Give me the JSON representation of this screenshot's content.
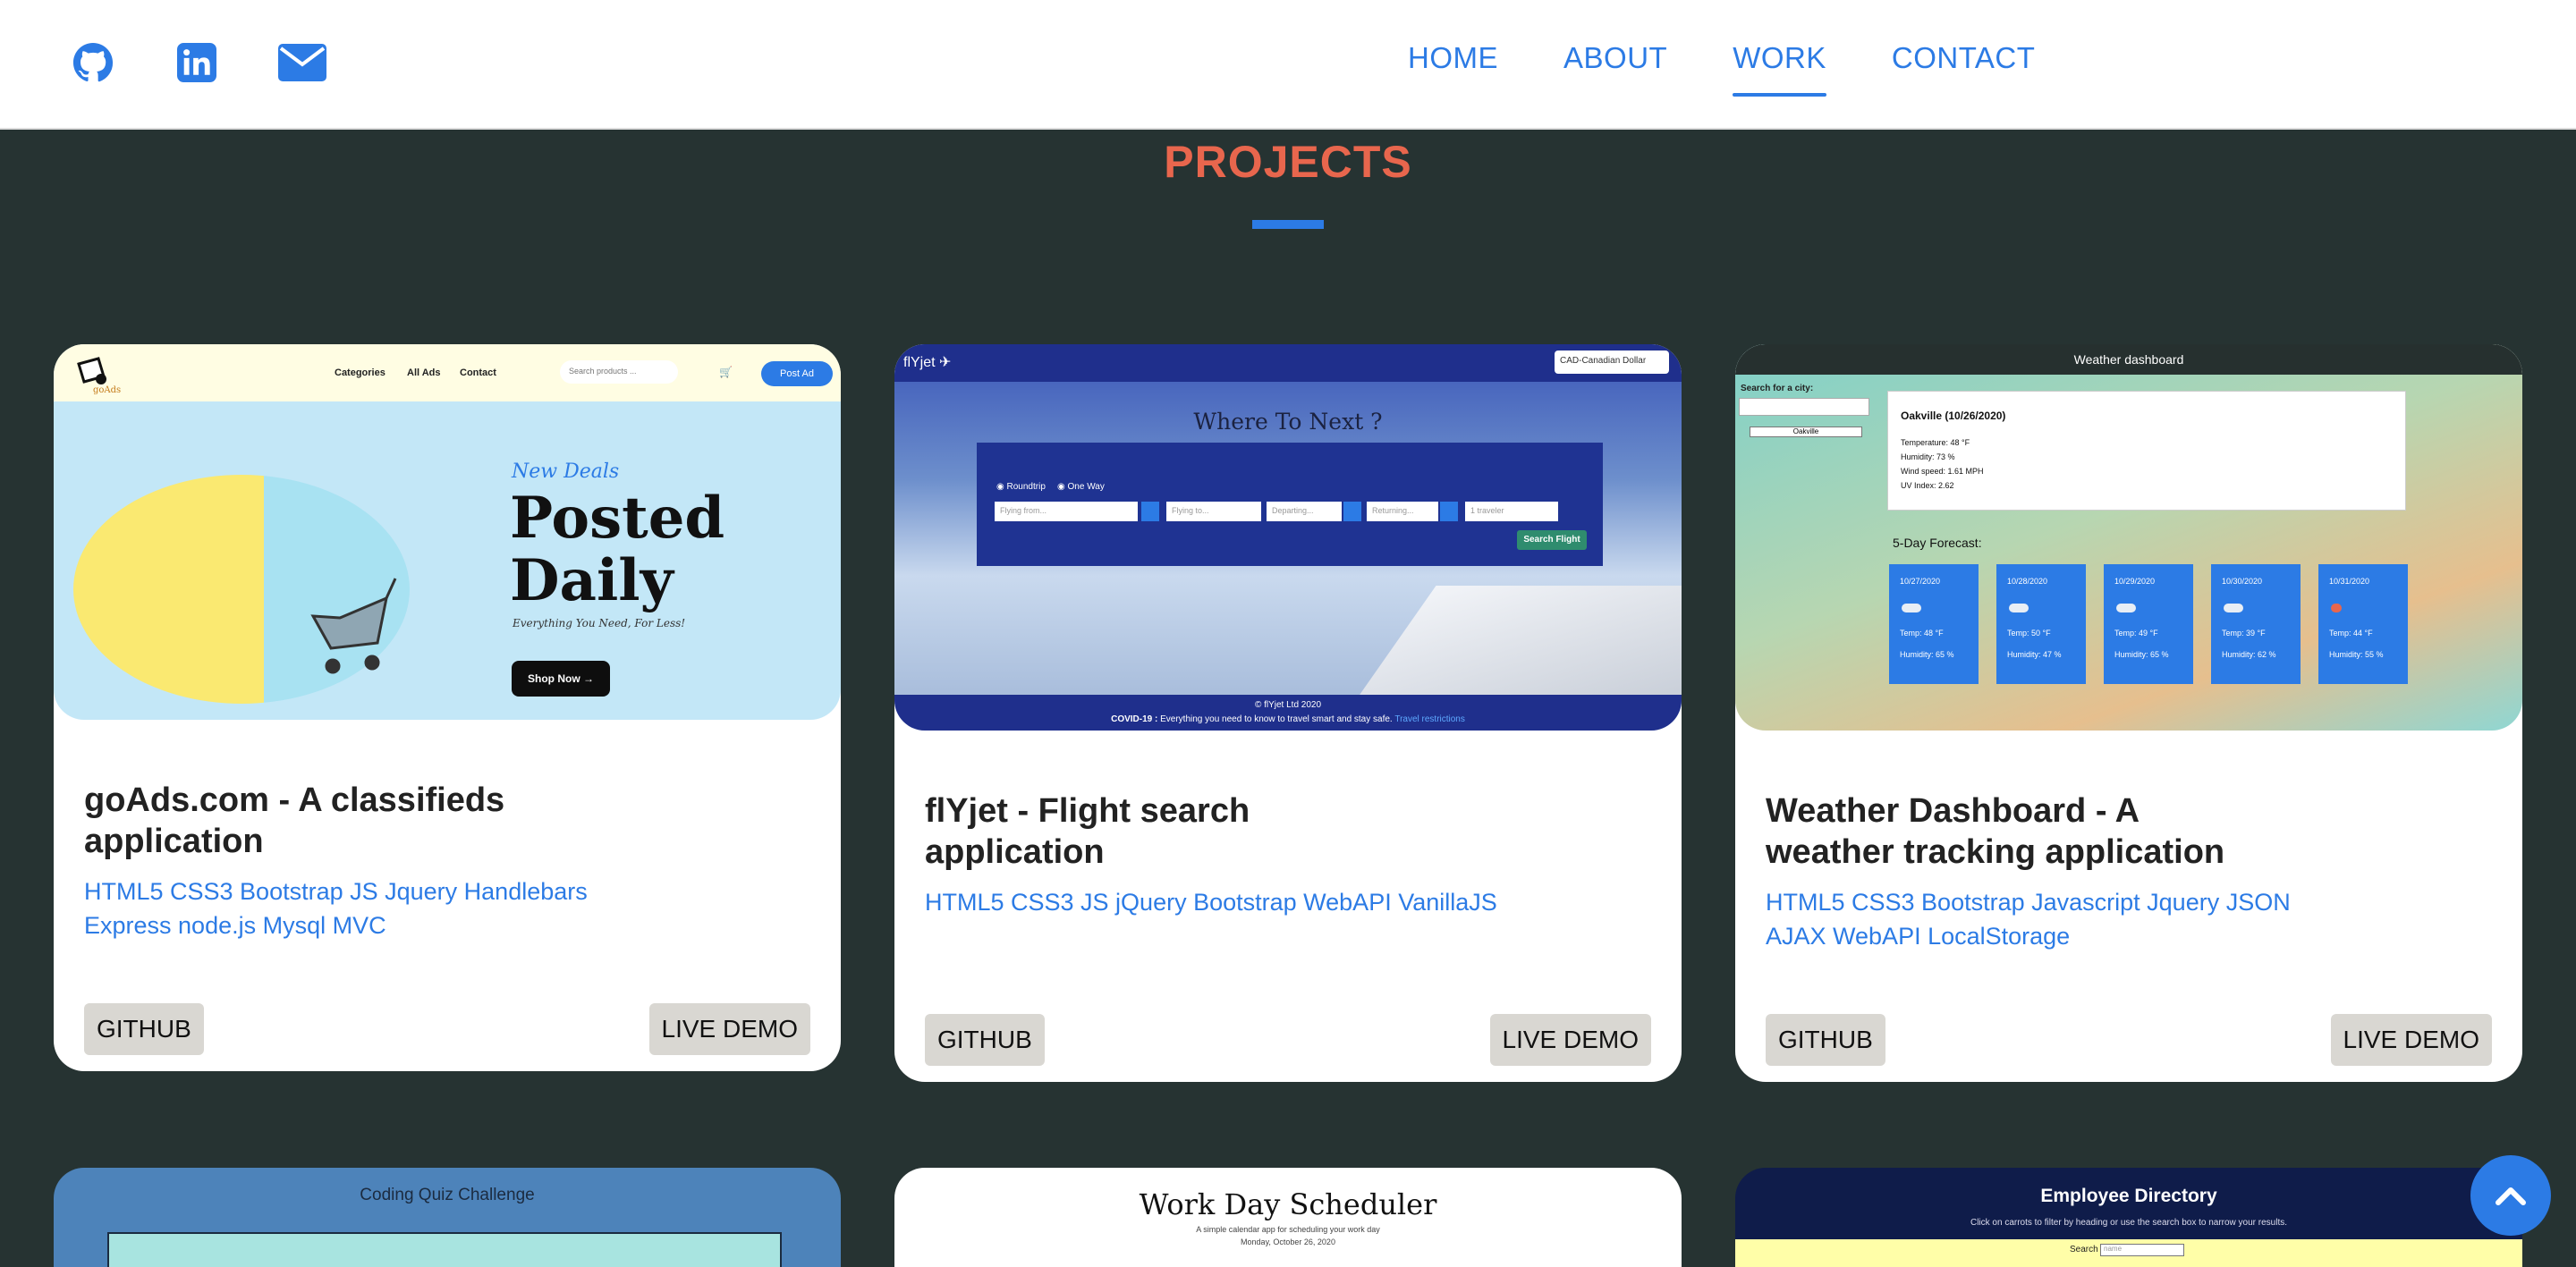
{
  "header": {
    "social": [
      {
        "icon": "github-icon"
      },
      {
        "icon": "linkedin-icon"
      },
      {
        "icon": "mail-icon"
      }
    ],
    "nav": [
      {
        "label": "HOME"
      },
      {
        "label": "ABOUT"
      },
      {
        "label": "WORK",
        "active": true
      },
      {
        "label": "CONTACT"
      }
    ]
  },
  "section": {
    "title": "PROJECTS"
  },
  "colors": {
    "accent": "#2c7be5",
    "title": "#e8664d",
    "background": "#263332"
  },
  "projects": [
    {
      "title": "goAds.com - A classifieds application",
      "tech": "HTML5 CSS3 Bootstrap JS Jquery Handlebars Express node.js Mysql MVC",
      "github_label": "GITHUB",
      "demo_label": "LIVE DEMO",
      "preview": {
        "logo_text": "goAds",
        "menu": [
          "Categories",
          "All Ads",
          "Contact"
        ],
        "search_placeholder": "Search products ...",
        "post_button": "Post Ad",
        "tagline": "New Deals",
        "headline_1": "Posted",
        "headline_2": "Daily",
        "subtext": "Everything You Need, For Less!",
        "cta": "Shop Now →"
      }
    },
    {
      "title": "flYjet - Flight search application",
      "tech": "HTML5 CSS3 JS jQuery Bootstrap WebAPI VanillaJS",
      "github_label": "GITHUB",
      "demo_label": "LIVE DEMO",
      "preview": {
        "brand": "flYjet",
        "currency": "CAD-Canadian Dollar",
        "headline": "Where To Next ?",
        "trip_options": [
          "Roundtrip",
          "One Way"
        ],
        "fields": [
          "Flying from...",
          "Flying to...",
          "Departing...",
          "Returning...",
          "1 traveler"
        ],
        "search_button": "Search Flight",
        "copyright": "© flYjet Ltd 2020",
        "covid_label": "COVID-19 :",
        "covid_text": "Everything you need to know to travel smart and stay safe.",
        "covid_link": "Travel restrictions"
      }
    },
    {
      "title": "Weather Dashboard - A weather tracking application",
      "tech": "HTML5 CSS3 Bootstrap Javascript Jquery JSON AJAX WebAPI LocalStorage",
      "github_label": "GITHUB",
      "demo_label": "LIVE DEMO",
      "preview": {
        "header": "Weather dashboard",
        "search_label": "Search for a city:",
        "city_button": "Oakville",
        "current_title": "Oakville (10/26/2020)",
        "temperature": "Temperature: 48 °F",
        "humidity": "Humidity: 73 %",
        "wind": "Wind speed: 1.61 MPH",
        "uv": "UV Index: 2.62",
        "forecast_label": "5-Day Forecast:",
        "forecast": [
          {
            "date": "10/27/2020",
            "temp": "Temp: 48 °F",
            "humidity": "Humidity: 65 %"
          },
          {
            "date": "10/28/2020",
            "temp": "Temp: 50 °F",
            "humidity": "Humidity: 47 %"
          },
          {
            "date": "10/29/2020",
            "temp": "Temp: 49 °F",
            "humidity": "Humidity: 65 %"
          },
          {
            "date": "10/30/2020",
            "temp": "Temp: 39 °F",
            "humidity": "Humidity: 62 %"
          },
          {
            "date": "10/31/2020",
            "temp": "Temp: 44 °F",
            "humidity": "Humidity: 55 %"
          }
        ]
      }
    }
  ],
  "more_previews": [
    {
      "title": "Coding Quiz Challenge"
    },
    {
      "title": "Work Day Scheduler",
      "subtitle": "A simple calendar app for scheduling your work day",
      "date": "Monday, October 26, 2020"
    },
    {
      "title": "Employee Directory",
      "subtitle": "Click on carrots to filter by heading or use the search box to narrow your results.",
      "search_label": "Search",
      "search_placeholder": "name"
    }
  ],
  "scroll_top": {
    "icon": "chevron-up-icon"
  }
}
